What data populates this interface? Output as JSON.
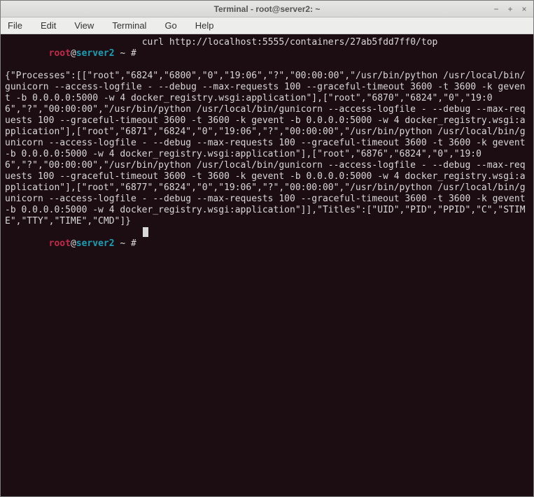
{
  "window": {
    "title": "Terminal - root@server2: ~"
  },
  "controls": {
    "minimize": "−",
    "maximize": "+",
    "close": "×"
  },
  "menubar": {
    "file": "File",
    "edit": "Edit",
    "view": "View",
    "terminal": "Terminal",
    "go": "Go",
    "help": "Help"
  },
  "prompt": {
    "user": "root",
    "at": "@",
    "host": "server2",
    "sep1": " ",
    "tilde": "~",
    "sep2": " ",
    "hash": "#",
    "sep3": " "
  },
  "command": "curl http://localhost:5555/containers/27ab5fdd7ff0/top",
  "output": "{\"Processes\":[[\"root\",\"6824\",\"6800\",\"0\",\"19:06\",\"?\",\"00:00:00\",\"/usr/bin/python /usr/local/bin/gunicorn --access-logfile - --debug --max-requests 100 --graceful-timeout 3600 -t 3600 -k gevent -b 0.0.0.0:5000 -w 4 docker_registry.wsgi:application\"],[\"root\",\"6870\",\"6824\",\"0\",\"19:06\",\"?\",\"00:00:00\",\"/usr/bin/python /usr/local/bin/gunicorn --access-logfile - --debug --max-requests 100 --graceful-timeout 3600 -t 3600 -k gevent -b 0.0.0.0:5000 -w 4 docker_registry.wsgi:application\"],[\"root\",\"6871\",\"6824\",\"0\",\"19:06\",\"?\",\"00:00:00\",\"/usr/bin/python /usr/local/bin/gunicorn --access-logfile - --debug --max-requests 100 --graceful-timeout 3600 -t 3600 -k gevent -b 0.0.0.0:5000 -w 4 docker_registry.wsgi:application\"],[\"root\",\"6876\",\"6824\",\"0\",\"19:06\",\"?\",\"00:00:00\",\"/usr/bin/python /usr/local/bin/gunicorn --access-logfile - --debug --max-requests 100 --graceful-timeout 3600 -t 3600 -k gevent -b 0.0.0.0:5000 -w 4 docker_registry.wsgi:application\"],[\"root\",\"6877\",\"6824\",\"0\",\"19:06\",\"?\",\"00:00:00\",\"/usr/bin/python /usr/local/bin/gunicorn --access-logfile - --debug --max-requests 100 --graceful-timeout 3600 -t 3600 -k gevent -b 0.0.0.0:5000 -w 4 docker_registry.wsgi:application\"]],\"Titles\":[\"UID\",\"PID\",\"PPID\",\"C\",\"STIME\",\"TTY\",\"TIME\",\"CMD\"]}"
}
